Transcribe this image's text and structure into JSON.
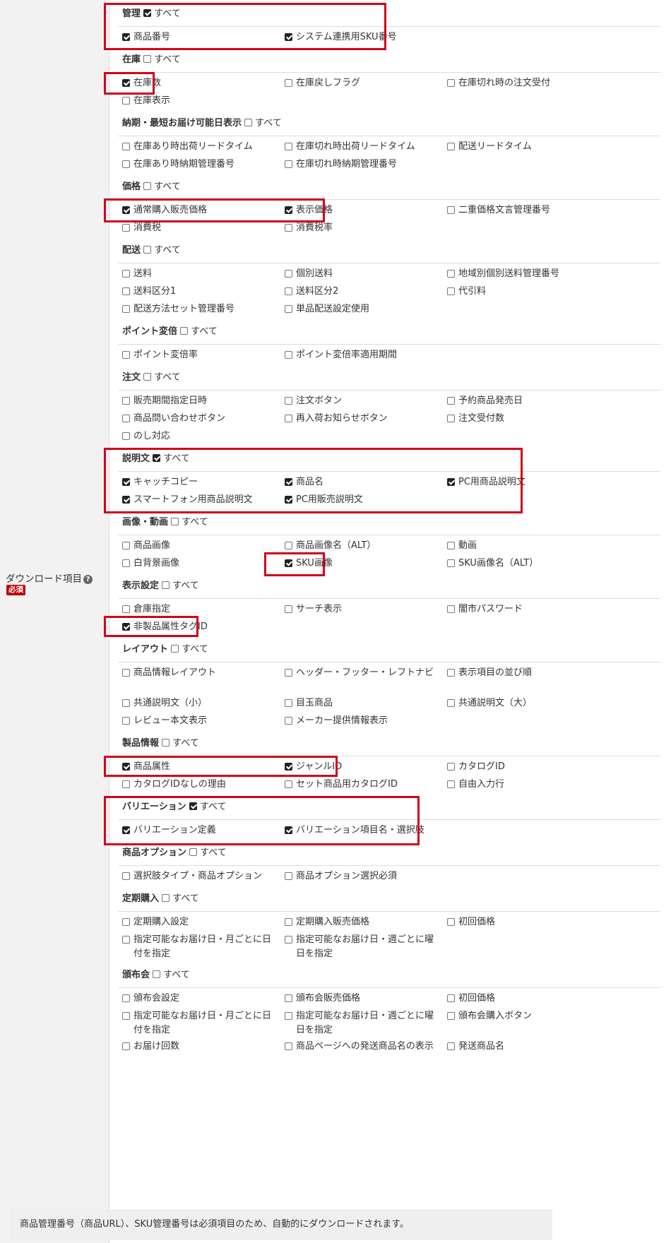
{
  "field": {
    "label": "ダウンロード項目",
    "help_icon": "question-circle-icon",
    "required": "必須"
  },
  "all_label": "すべて",
  "groups": [
    {
      "id": "kanri",
      "name": "管理",
      "all_checked": true,
      "items": [
        {
          "label": "商品番号",
          "checked": true
        },
        {
          "label": "システム連携用SKU番号",
          "checked": true
        }
      ]
    },
    {
      "id": "zaiko",
      "name": "在庫",
      "all_checked": false,
      "items": [
        {
          "label": "在庫数",
          "checked": true
        },
        {
          "label": "在庫戻しフラグ",
          "checked": false
        },
        {
          "label": "在庫切れ時の注文受付",
          "checked": false
        },
        {
          "label": "在庫表示",
          "checked": false
        }
      ]
    },
    {
      "id": "noki",
      "name": "納期・最短お届け可能日表示",
      "all_checked": false,
      "items": [
        {
          "label": "在庫あり時出荷リードタイム",
          "checked": false
        },
        {
          "label": "在庫切れ時出荷リードタイム",
          "checked": false
        },
        {
          "label": "配送リードタイム",
          "checked": false
        },
        {
          "label": "在庫あり時納期管理番号",
          "checked": false
        },
        {
          "label": "在庫切れ時納期管理番号",
          "checked": false
        }
      ]
    },
    {
      "id": "kakaku",
      "name": "価格",
      "all_checked": false,
      "items": [
        {
          "label": "通常購入販売価格",
          "checked": true
        },
        {
          "label": "表示価格",
          "checked": true
        },
        {
          "label": "二重価格文言管理番号",
          "checked": false
        },
        {
          "label": "消費税",
          "checked": false
        },
        {
          "label": "消費税率",
          "checked": false
        }
      ]
    },
    {
      "id": "haiso",
      "name": "配送",
      "all_checked": false,
      "items": [
        {
          "label": "送料",
          "checked": false
        },
        {
          "label": "個別送料",
          "checked": false
        },
        {
          "label": "地域別個別送料管理番号",
          "checked": false
        },
        {
          "label": "送料区分1",
          "checked": false
        },
        {
          "label": "送料区分2",
          "checked": false
        },
        {
          "label": "代引料",
          "checked": false
        },
        {
          "label": "配送方法セット管理番号",
          "checked": false
        },
        {
          "label": "単品配送設定使用",
          "checked": false
        }
      ]
    },
    {
      "id": "point",
      "name": "ポイント変倍",
      "all_checked": false,
      "items": [
        {
          "label": "ポイント変倍率",
          "checked": false
        },
        {
          "label": "ポイント変倍率適用期間",
          "checked": false
        }
      ]
    },
    {
      "id": "chumon",
      "name": "注文",
      "all_checked": false,
      "items": [
        {
          "label": "販売期間指定日時",
          "checked": false
        },
        {
          "label": "注文ボタン",
          "checked": false
        },
        {
          "label": "予約商品発売日",
          "checked": false
        },
        {
          "label": "商品問い合わせボタン",
          "checked": false
        },
        {
          "label": "再入荷お知らせボタン",
          "checked": false
        },
        {
          "label": "注文受付数",
          "checked": false
        },
        {
          "label": "のし対応",
          "checked": false
        }
      ]
    },
    {
      "id": "setsumei",
      "name": "説明文",
      "all_checked": true,
      "items": [
        {
          "label": "キャッチコピー",
          "checked": true
        },
        {
          "label": "商品名",
          "checked": true
        },
        {
          "label": "PC用商品説明文",
          "checked": true
        },
        {
          "label": "スマートフォン用商品説明文",
          "checked": true
        },
        {
          "label": "PC用販売説明文",
          "checked": true
        }
      ]
    },
    {
      "id": "gazo",
      "name": "画像・動画",
      "all_checked": false,
      "items": [
        {
          "label": "商品画像",
          "checked": false
        },
        {
          "label": "商品画像名（ALT）",
          "checked": false
        },
        {
          "label": "動画",
          "checked": false
        },
        {
          "label": "白背景画像",
          "checked": false
        },
        {
          "label": "SKU画像",
          "checked": true
        },
        {
          "label": "SKU画像名（ALT）",
          "checked": false
        }
      ]
    },
    {
      "id": "hyoji",
      "name": "表示設定",
      "all_checked": false,
      "items": [
        {
          "label": "倉庫指定",
          "checked": false
        },
        {
          "label": "サーチ表示",
          "checked": false
        },
        {
          "label": "闇市パスワード",
          "checked": false
        },
        {
          "label": "非製品属性タグID",
          "checked": true
        }
      ]
    },
    {
      "id": "layout",
      "name": "レイアウト",
      "all_checked": false,
      "items": [
        {
          "label": "商品情報レイアウト",
          "checked": false
        },
        {
          "label": "ヘッダー・フッター・レフトナビ",
          "checked": false
        },
        {
          "label": "表示項目の並び順",
          "checked": false
        },
        {
          "label": "共通説明文（小）",
          "checked": false
        },
        {
          "label": "目玉商品",
          "checked": false
        },
        {
          "label": "共通説明文（大）",
          "checked": false
        },
        {
          "label": "レビュー本文表示",
          "checked": false
        },
        {
          "label": "メーカー提供情報表示",
          "checked": false
        }
      ]
    },
    {
      "id": "seihin",
      "name": "製品情報",
      "all_checked": false,
      "items": [
        {
          "label": "商品属性",
          "checked": true
        },
        {
          "label": "ジャンルID",
          "checked": true
        },
        {
          "label": "カタログID",
          "checked": false
        },
        {
          "label": "カタログIDなしの理由",
          "checked": false
        },
        {
          "label": "セット商品用カタログID",
          "checked": false
        },
        {
          "label": "自由入力行",
          "checked": false
        }
      ]
    },
    {
      "id": "variation",
      "name": "バリエーション",
      "all_checked": true,
      "items": [
        {
          "label": "バリエーション定義",
          "checked": true
        },
        {
          "label": "バリエーション項目名・選択肢",
          "checked": true
        }
      ]
    },
    {
      "id": "option",
      "name": "商品オプション",
      "all_checked": false,
      "items": [
        {
          "label": "選択肢タイプ・商品オプション",
          "checked": false
        },
        {
          "label": "商品オプション選択必須",
          "checked": false
        }
      ]
    },
    {
      "id": "teiki",
      "name": "定期購入",
      "all_checked": false,
      "items": [
        {
          "label": "定期購入設定",
          "checked": false
        },
        {
          "label": "定期購入販売価格",
          "checked": false
        },
        {
          "label": "初回価格",
          "checked": false
        },
        {
          "label": "指定可能なお届け日・月ごとに日付を指定",
          "checked": false
        },
        {
          "label": "指定可能なお届け日・週ごとに曜日を指定",
          "checked": false
        }
      ]
    },
    {
      "id": "hanpukai",
      "name": "頒布会",
      "all_checked": false,
      "items": [
        {
          "label": "頒布会設定",
          "checked": false
        },
        {
          "label": "頒布会販売価格",
          "checked": false
        },
        {
          "label": "初回価格",
          "checked": false
        },
        {
          "label": "指定可能なお届け日・月ごとに日付を指定",
          "checked": false
        },
        {
          "label": "指定可能なお届け日・週ごとに曜日を指定",
          "checked": false
        },
        {
          "label": "頒布会購入ボタン",
          "checked": false
        },
        {
          "label": "お届け回数",
          "checked": false
        },
        {
          "label": "商品ページへの発送商品名の表示",
          "checked": false
        },
        {
          "label": "発送商品名",
          "checked": false
        }
      ]
    }
  ],
  "note": "商品管理番号（商品URL）、SKU管理番号は必須項目のため、自動的にダウンロードされます。",
  "highlight_color": "#d0021b"
}
